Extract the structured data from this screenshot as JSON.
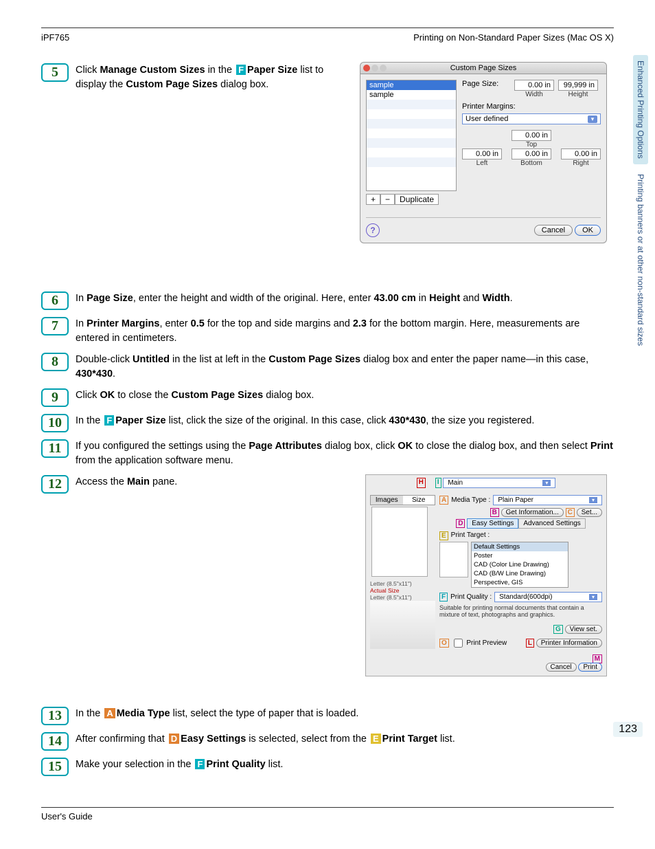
{
  "header": {
    "product": "iPF765",
    "section": "Printing on Non-Standard Paper Sizes (Mac OS X)"
  },
  "sideTabs": {
    "tab1": "Enhanced Printing Options",
    "tab2": "Printing banners or at other non-standard sizes"
  },
  "steps": {
    "s5a": "Click ",
    "s5b": "Manage Custom Sizes",
    "s5c": " in the ",
    "s5d": "Paper Size",
    "s5e": " list to display the ",
    "s5f": "Custom Page Sizes",
    "s5g": " dialog box.",
    "s6a": "In ",
    "s6b": "Page Size",
    "s6c": ", enter the height and width of the original. Here, enter ",
    "s6d": "43.00 cm",
    "s6e": " in ",
    "s6f": "Height",
    "s6g": " and ",
    "s6h": "Width",
    "s6i": ".",
    "s7a": "In ",
    "s7b": "Printer Margins",
    "s7c": ", enter ",
    "s7d": "0.5",
    "s7e": " for the top and side margins and ",
    "s7f": "2.3",
    "s7g": " for the bottom margin. Here, measurements are entered in centimeters.",
    "s8a": "Double-click ",
    "s8b": "Untitled",
    "s8c": " in the list at left in the ",
    "s8d": "Custom Page Sizes",
    "s8e": " dialog box and enter the paper name—in this case, ",
    "s8f": "430*430",
    "s8g": ".",
    "s9a": "Click ",
    "s9b": "OK",
    "s9c": " to close the ",
    "s9d": "Custom Page Sizes",
    "s9e": " dialog box.",
    "s10a": "In the ",
    "s10b": "Paper Size",
    "s10c": " list, click the size of the original. In this case, click ",
    "s10d": "430*430",
    "s10e": ", the size you registered.",
    "s11a": "If you configured the settings using the ",
    "s11b": "Page Attributes",
    "s11c": " dialog box, click ",
    "s11d": "OK",
    "s11e": " to close the dialog box, and then select ",
    "s11f": "Print",
    "s11g": " from the application software menu.",
    "s12a": "Access the ",
    "s12b": "Main",
    "s12c": " pane.",
    "s13a": "In the ",
    "s13b": "Media Type",
    "s13c": " list, select the type of paper that is loaded.",
    "s14a": "After confirming that ",
    "s14b": "Easy Settings",
    "s14c": " is selected, select from the ",
    "s14d": "Print Target",
    "s14e": " list.",
    "s15a": "Make your selection in the ",
    "s15b": "Print Quality",
    "s15c": " list."
  },
  "dlg5": {
    "title": "Custom Page Sizes",
    "list": [
      "sample",
      "sample"
    ],
    "pageSizeLabel": "Page Size:",
    "width": "0.00 in",
    "widthLabel": "Width",
    "height": "99,999 in",
    "heightLabel": "Height",
    "marginsLabel": "Printer Margins:",
    "userDefined": "User defined",
    "top": "0.00 in",
    "topLabel": "Top",
    "left": "0.00 in",
    "leftLabel": "Left",
    "right": "0.00 in",
    "rightLabel": "Right",
    "bottom": "0.00 in",
    "bottomLabel": "Bottom",
    "add": "+",
    "remove": "−",
    "duplicate": "Duplicate",
    "cancel": "Cancel",
    "ok": "OK"
  },
  "dlg12": {
    "topSelect": "Main",
    "tabImages": "Images",
    "tabSize": "Size",
    "mediaTypeLabel": "Media Type :",
    "mediaType": "Plain Paper",
    "getInfo": "Get Information...",
    "set": "Set...",
    "easy": "Easy Settings",
    "advanced": "Advanced Settings",
    "printTargetLabel": "Print Target :",
    "targets": [
      "Default Settings",
      "Poster",
      "CAD (Color Line Drawing)",
      "CAD (B/W Line Drawing)",
      "Perspective, GIS"
    ],
    "printQualityLabel": "Print Quality :",
    "quality": "Standard(600dpi)",
    "hint": "Suitable for printing normal documents that contain a mixture of text, photographs and graphics.",
    "viewSet": "View set.",
    "printPreview": "Print Preview",
    "printerInfo": "Printer Information",
    "cancel": "Cancel",
    "print": "Print",
    "sizeText1": "Letter (8.5\"x11\")",
    "sizeText2": "Actual Size",
    "sizeText3": "Letter (8.5\"x11\")"
  },
  "nums": {
    "n5": "5",
    "n6": "6",
    "n7": "7",
    "n8": "8",
    "n9": "9",
    "n10": "10",
    "n11": "11",
    "n12": "12",
    "n13": "13",
    "n14": "14",
    "n15": "15"
  },
  "pageNumber": "123",
  "footer": "User's Guide",
  "letters": {
    "F": "F",
    "A": "A",
    "D": "D",
    "E": "E"
  }
}
